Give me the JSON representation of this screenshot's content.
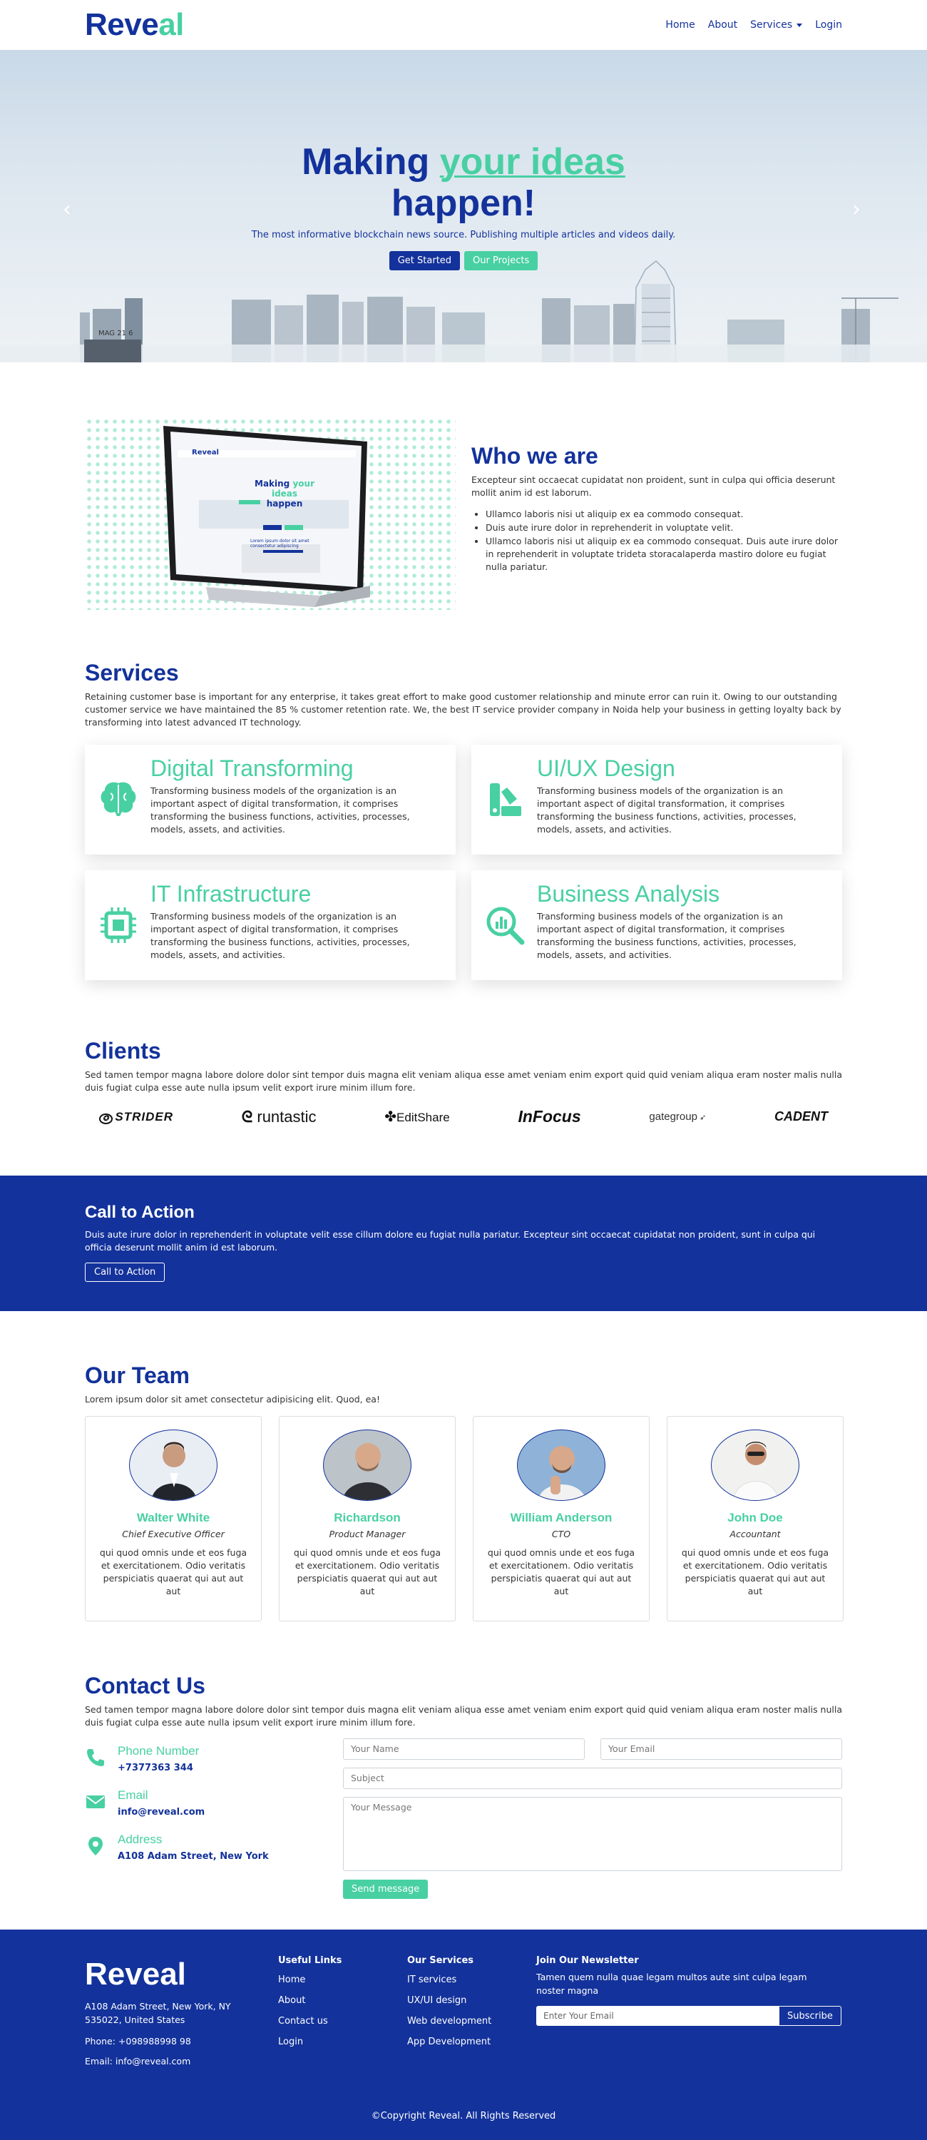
{
  "nav": {
    "brand_a": "Reve",
    "brand_b": "al",
    "items": [
      "Home",
      "About",
      "Services",
      "Login"
    ]
  },
  "hero": {
    "title_a": "Making ",
    "title_hl": "your ideas",
    "title_b": "happen!",
    "subtitle": "The most informative blockchain news source. Publishing multiple articles and videos daily.",
    "btn_start": "Get Started",
    "btn_projects": "Our Projects",
    "sign_text": "MAG 21 6"
  },
  "who": {
    "title": "Who we are",
    "intro": "Excepteur sint occaecat cupidatat non proident, sunt in culpa qui officia deserunt mollit anim id est laborum.",
    "bullets": [
      "Ullamco laboris nisi ut aliquip ex ea commodo consequat.",
      "Duis aute irure dolor in reprehenderit in voluptate velit.",
      "Ullamco laboris nisi ut aliquip ex ea commodo consequat. Duis aute irure dolor in reprehenderit in voluptate trideta storacalaperda mastiro dolore eu fugiat nulla pariatur."
    ],
    "screen_brand": "Reveal",
    "screen_title_a": "Making ",
    "screen_title_hl": "your ideas",
    "screen_title_b": "happen",
    "screen_caption": "Lorem ipsum dolor sit amet consectetur adipiscing"
  },
  "services": {
    "title": "Services",
    "intro": "Retaining customer base is important for any enterprise, it takes great effort to make good customer relationship and minute error can ruin it. Owing to our outstanding customer service we have maintained the 85 % customer retention rate. We, the best IT service provider company in Noida help your business in getting loyalty back by transforming into latest advanced IT technology.",
    "items": [
      {
        "title": "Digital Transforming",
        "icon": "brain-icon",
        "desc": "Transforming business models of the organization is an important aspect of digital transformation, it comprises transforming the business functions, activities, processes, models, assets, and activities."
      },
      {
        "title": "UI/UX Design",
        "icon": "palette-icon",
        "desc": "Transforming business models of the organization is an important aspect of digital transformation, it comprises transforming the business functions, activities, processes, models, assets, and activities."
      },
      {
        "title": "IT Infrastructure",
        "icon": "chip-icon",
        "desc": "Transforming business models of the organization is an important aspect of digital transformation, it comprises transforming the business functions, activities, processes, models, assets, and activities."
      },
      {
        "title": "Business Analysis",
        "icon": "analysis-icon",
        "desc": "Transforming business models of the organization is an important aspect of digital transformation, it comprises transforming the business functions, activities, processes, models, assets, and activities."
      }
    ]
  },
  "clients": {
    "title": "Clients",
    "intro": "Sed tamen tempor magna labore dolore dolor sint tempor duis magna elit veniam aliqua esse amet veniam enim export quid quid veniam aliqua eram noster malis nulla duis fugiat culpa esse aute nulla ipsum velit export irure minim illum fore.",
    "logos": [
      "STRIDER",
      "runtastic",
      "EditShare",
      "InFocus",
      "gategroup",
      "CADENT"
    ]
  },
  "cta": {
    "title": "Call to Action",
    "text": "Duis aute irure dolor in reprehenderit in voluptate velit esse cillum dolore eu fugiat nulla pariatur. Excepteur sint occaecat cupidatat non proident, sunt in culpa qui officia deserunt mollit anim id est laborum.",
    "button": "Call to Action"
  },
  "team": {
    "title": "Our Team",
    "intro": "Lorem ipsum dolor sit amet consectetur adipisicing elit. Quod, ea!",
    "members": [
      {
        "name": "Walter White",
        "role": "Chief Executive Officer",
        "desc": "qui quod omnis unde et eos fuga et exercitationem. Odio veritatis perspiciatis quaerat qui aut aut aut"
      },
      {
        "name": "Richardson",
        "role": "Product Manager",
        "desc": "qui quod omnis unde et eos fuga et exercitationem. Odio veritatis perspiciatis quaerat qui aut aut aut"
      },
      {
        "name": "William Anderson",
        "role": "CTO",
        "desc": "qui quod omnis unde et eos fuga et exercitationem. Odio veritatis perspiciatis quaerat qui aut aut aut"
      },
      {
        "name": "John Doe",
        "role": "Accountant",
        "desc": "qui quod omnis unde et eos fuga et exercitationem. Odio veritatis perspiciatis quaerat qui aut aut aut"
      }
    ]
  },
  "contact": {
    "title": "Contact Us",
    "intro": "Sed tamen tempor magna labore dolore dolor sint tempor duis magna elit veniam aliqua esse amet veniam enim export quid quid veniam aliqua eram noster malis nulla duis fugiat culpa esse aute nulla ipsum velit export irure minim illum fore.",
    "phone_label": "Phone Number",
    "phone": "+7377363 344",
    "email_label": "Email",
    "email": "info@reveal.com",
    "address_label": "Address",
    "address": "A108 Adam Street, New York",
    "name_ph": "Your Name",
    "email_ph": "Your Email",
    "subject_ph": "Subject",
    "message_ph": "Your Message",
    "send": "Send message"
  },
  "footer": {
    "brand": "Reveal",
    "address": "A108 Adam Street, New York, NY 535022, United States",
    "phone": "Phone: +098988998 98",
    "email": "Email: info@reveal.com",
    "useful_title": "Useful Links",
    "useful": [
      "Home",
      "About",
      "Contact us",
      "Login"
    ],
    "services_title": "Our Services",
    "services": [
      "IT services",
      "UX/UI design",
      "Web development",
      "App Development"
    ],
    "news_title": "Join Our Newsletter",
    "news_text": "Tamen quem nulla quae legam multos aute sint culpa legam noster magna",
    "news_ph": "Enter Your Email",
    "subscribe": "Subscribe",
    "copyright": "©Copyright Reveal. All Rights Reserved"
  },
  "colors": {
    "primary": "#13329b",
    "accent": "#48d0a2"
  }
}
